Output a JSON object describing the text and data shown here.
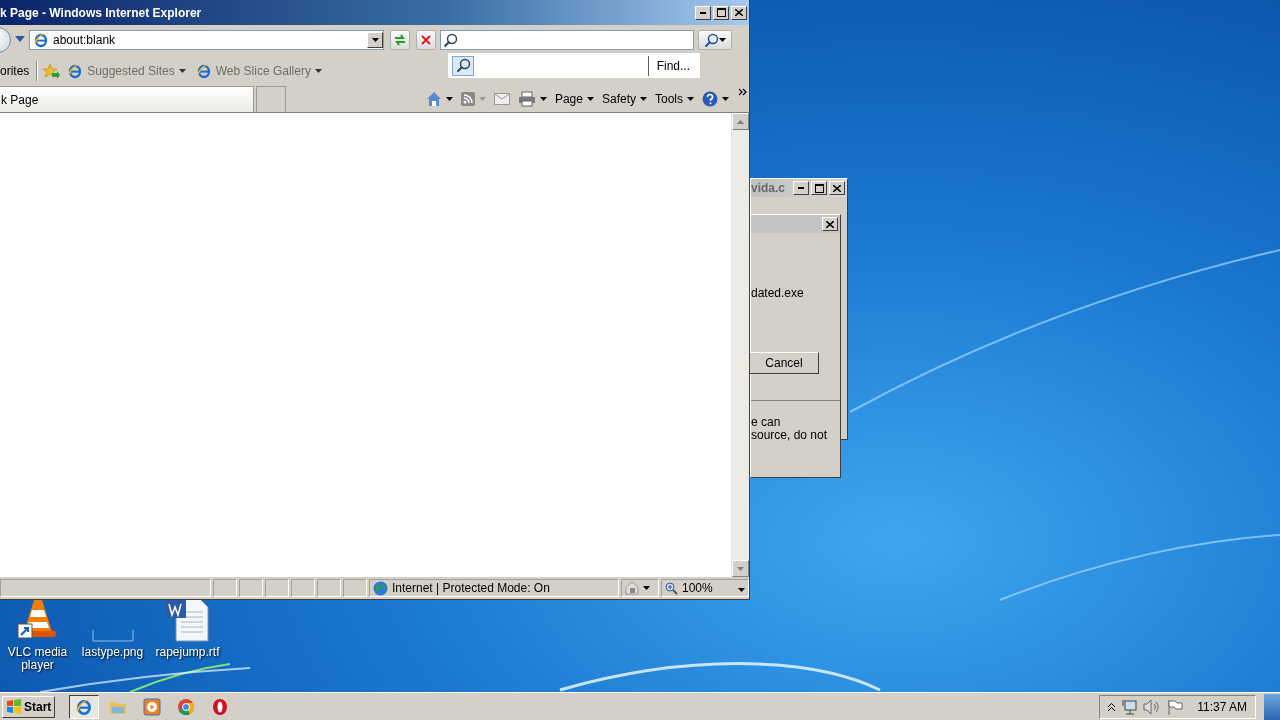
{
  "ie_window": {
    "title": "k Page - Windows Internet Explorer",
    "address": "about:blank",
    "search_menu": {
      "find": "Find..."
    },
    "favorites_bar": {
      "label": "orites",
      "links": [
        {
          "label": "Suggested Sites"
        },
        {
          "label": "Web Slice Gallery"
        }
      ]
    },
    "tabs": [
      {
        "label": "k Page",
        "selected": true
      }
    ],
    "commands": [
      {
        "label": "Page"
      },
      {
        "label": "Safety"
      },
      {
        "label": "Tools"
      }
    ],
    "status_bar": {
      "zone": "Internet | Protected Mode: On",
      "zoom": "100%"
    }
  },
  "back_window": {
    "title": "vida.c"
  },
  "dialog": {
    "file": "dated.exe",
    "cancel": "Cancel",
    "note_lines": [
      "e can",
      "source, do not"
    ]
  },
  "desktop_icons": [
    {
      "kind": "vlc",
      "label": "VLC media player"
    },
    {
      "kind": "image",
      "label": "lastype.png"
    },
    {
      "kind": "word",
      "label": "rapejump.rtf"
    }
  ],
  "taskbar": {
    "start": "Start",
    "apps": [
      {
        "kind": "ie",
        "active": true
      },
      {
        "kind": "folder",
        "active": false
      },
      {
        "kind": "media",
        "active": false
      },
      {
        "kind": "chrome",
        "active": false
      },
      {
        "kind": "opera",
        "active": false
      }
    ],
    "clock": "11:37 AM"
  }
}
